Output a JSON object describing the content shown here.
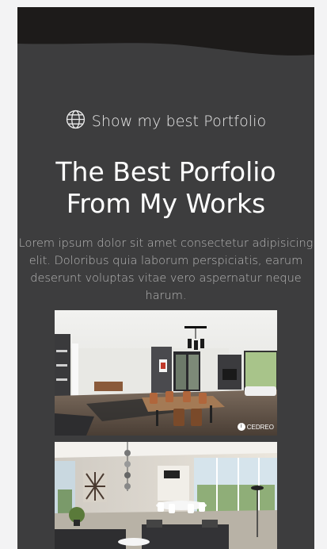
{
  "hero": {
    "eyebrow_icon": "globe-icon",
    "eyebrow": "Show my best Portfolio",
    "title_line1": "The Best Porfolio",
    "title_line2": "From My Works",
    "description": "Lorem ipsum dolor sit amet consectetur adipisicing elit. Doloribus quia laborum perspiciatis, earum deserunt voluptas vitae vero aspernatur neque harum."
  },
  "portfolio": {
    "items": [
      {
        "subject": "modern open-plan interior with dining table",
        "watermark": "CEDREO"
      },
      {
        "subject": "bright living room with large windows"
      }
    ]
  },
  "colors": {
    "page_bg": "#3d3d3e",
    "header_wave": "#1d1b1a",
    "outer_bg": "#f3f3f4",
    "title": "#ffffff",
    "text_muted": "#b7b7b7"
  }
}
